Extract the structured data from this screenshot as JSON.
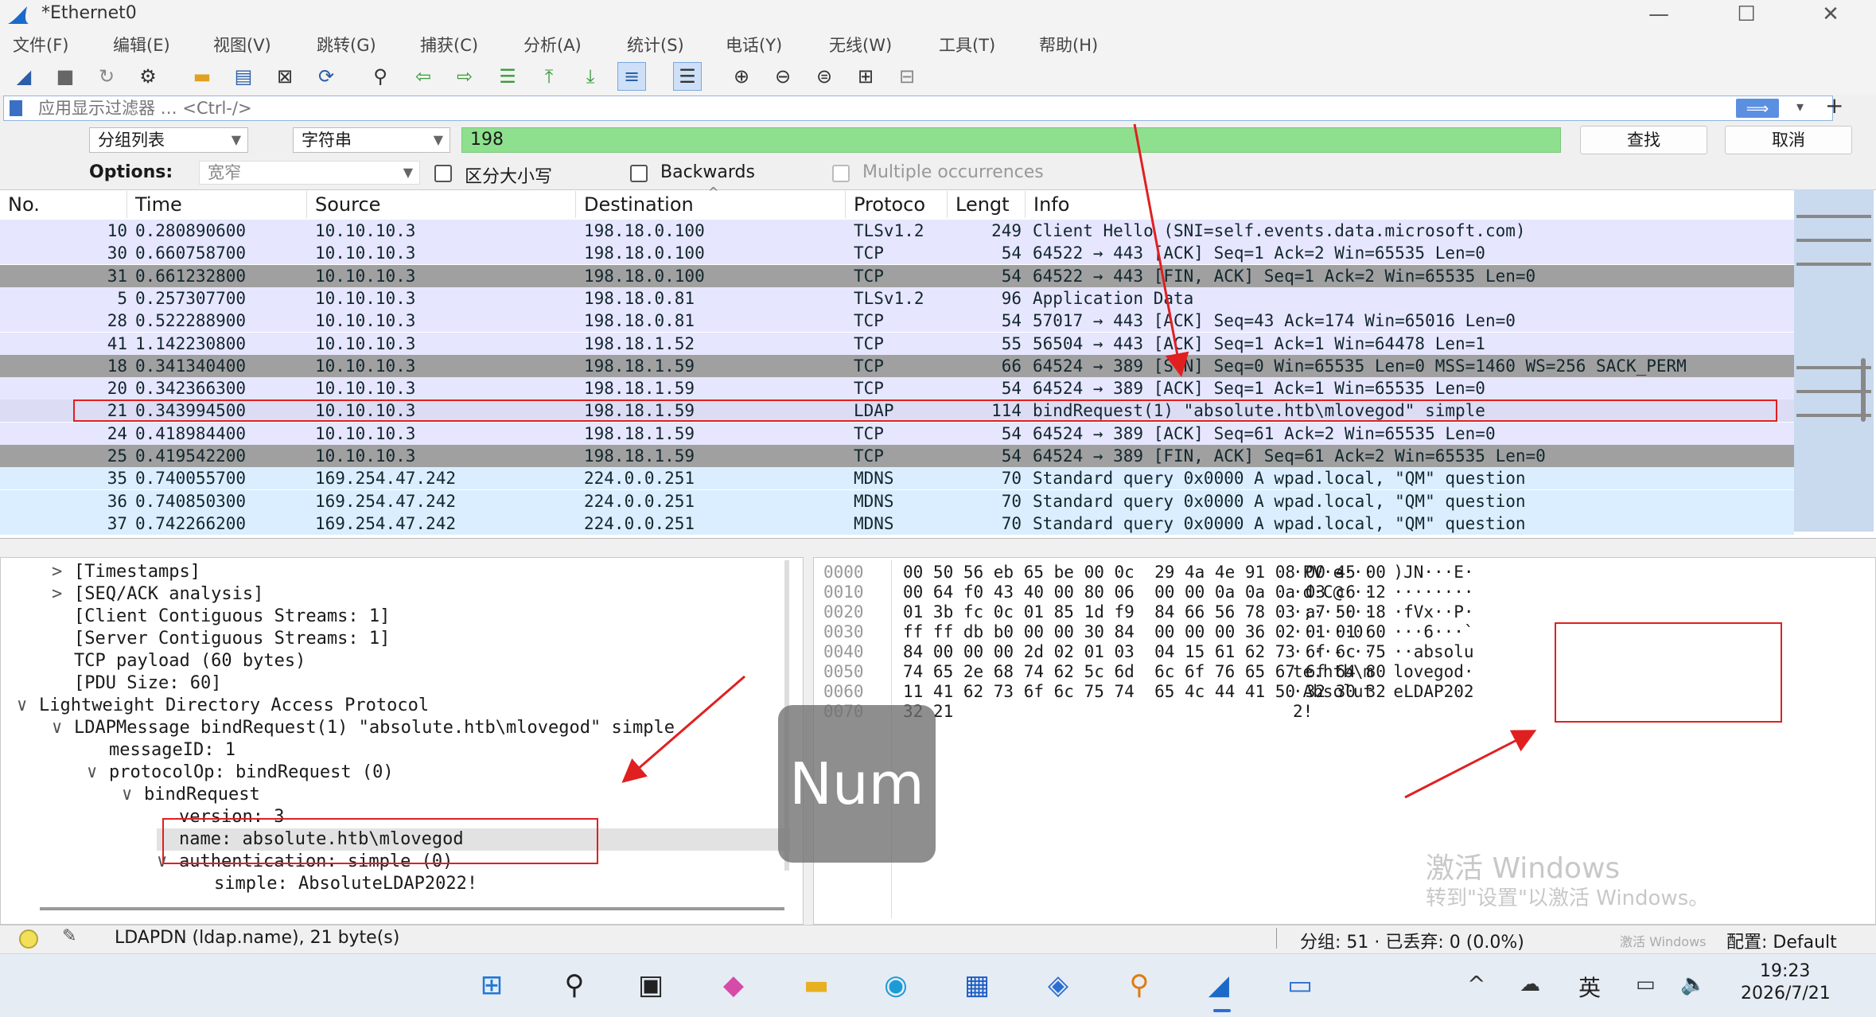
{
  "window": {
    "title": "*Ethernet0",
    "controls": [
      "—",
      "☐",
      "✕"
    ]
  },
  "menu": [
    "文件(F)",
    "编辑(E)",
    "视图(V)",
    "跳转(G)",
    "捕获(C)",
    "分析(A)",
    "统计(S)",
    "电话(Y)",
    "无线(W)",
    "工具(T)",
    "帮助(H)"
  ],
  "toolbar_icons": [
    "shark-fin-icon",
    "stop-icon",
    "restart-icon",
    "options-icon",
    "open-icon",
    "save-icon",
    "close-file-icon",
    "reload-icon",
    "find-icon",
    "back-icon",
    "forward-icon",
    "goto-icon",
    "first-icon",
    "last-icon",
    "autoscroll-icon",
    "colorize-icon",
    "zoom-in-icon",
    "zoom-out-icon",
    "zoom-reset-icon",
    "resize-columns-icon",
    "layout-icon"
  ],
  "filter": {
    "placeholder": "应用显示过滤器 … <Ctrl-/>",
    "add": "+"
  },
  "find": {
    "scope": "分组列表",
    "type": "字符串",
    "value": "198",
    "find_label": "查找",
    "cancel_label": "取消",
    "options_label": "Options:",
    "charset": "宽窄",
    "case": "区分大小写",
    "backwards": "Backwards",
    "multiple": "Multiple occurrences"
  },
  "packet_list": {
    "columns": [
      "No.",
      "Time",
      "Source",
      "Destination",
      "Protoco",
      "Lengt",
      "Info"
    ],
    "rows": [
      {
        "no": "10",
        "time": "0.280890600",
        "src": "10.10.10.3",
        "dst": "198.18.0.100",
        "proto": "TLSv1.2",
        "len": "249",
        "info": "Client Hello (SNI=self.events.data.microsoft.com)",
        "bg": "#e7e6ff",
        "fg": "#12272e"
      },
      {
        "no": "30",
        "time": "0.660758700",
        "src": "10.10.10.3",
        "dst": "198.18.0.100",
        "proto": "TCP",
        "len": "54",
        "info": "64522 → 443 [ACK] Seq=1 Ack=2 Win=65535 Len=0",
        "bg": "#e7e6ff",
        "fg": "#12272e"
      },
      {
        "no": "31",
        "time": "0.661232800",
        "src": "10.10.10.3",
        "dst": "198.18.0.100",
        "proto": "TCP",
        "len": "54",
        "info": "64522 → 443 [FIN, ACK] Seq=1 Ack=2 Win=65535 Len=0",
        "bg": "#a0a0a0",
        "fg": "#12272e"
      },
      {
        "no": "5",
        "time": "0.257307700",
        "src": "10.10.10.3",
        "dst": "198.18.0.81",
        "proto": "TLSv1.2",
        "len": "96",
        "info": "Application Data",
        "bg": "#e7e6ff",
        "fg": "#12272e"
      },
      {
        "no": "28",
        "time": "0.522288900",
        "src": "10.10.10.3",
        "dst": "198.18.0.81",
        "proto": "TCP",
        "len": "54",
        "info": "57017 → 443 [ACK] Seq=43 Ack=174 Win=65016 Len=0",
        "bg": "#e7e6ff",
        "fg": "#12272e"
      },
      {
        "no": "41",
        "time": "1.142230800",
        "src": "10.10.10.3",
        "dst": "198.18.1.52",
        "proto": "TCP",
        "len": "55",
        "info": "56504 → 443 [ACK] Seq=1 Ack=1 Win=64478 Len=1",
        "bg": "#e7e6ff",
        "fg": "#12272e"
      },
      {
        "no": "18",
        "time": "0.341340400",
        "src": "10.10.10.3",
        "dst": "198.18.1.59",
        "proto": "TCP",
        "len": "66",
        "info": "64524 → 389 [SYN] Seq=0 Win=65535 Len=0 MSS=1460 WS=256 SACK_PERM",
        "bg": "#a0a0a0",
        "fg": "#12272e"
      },
      {
        "no": "20",
        "time": "0.342366300",
        "src": "10.10.10.3",
        "dst": "198.18.1.59",
        "proto": "TCP",
        "len": "54",
        "info": "64524 → 389 [ACK] Seq=1 Ack=1 Win=65535 Len=0",
        "bg": "#e7e6ff",
        "fg": "#12272e"
      },
      {
        "no": "21",
        "time": "0.343994500",
        "src": "10.10.10.3",
        "dst": "198.18.1.59",
        "proto": "LDAP",
        "len": "114",
        "info": "bindRequest(1) \"absolute.htb\\mlovegod\" simple",
        "bg": "#dcdcf4",
        "fg": "#12272e"
      },
      {
        "no": "24",
        "time": "0.418984400",
        "src": "10.10.10.3",
        "dst": "198.18.1.59",
        "proto": "TCP",
        "len": "54",
        "info": "64524 → 389 [ACK] Seq=61 Ack=2 Win=65535 Len=0",
        "bg": "#e7e6ff",
        "fg": "#12272e"
      },
      {
        "no": "25",
        "time": "0.419542200",
        "src": "10.10.10.3",
        "dst": "198.18.1.59",
        "proto": "TCP",
        "len": "54",
        "info": "64524 → 389 [FIN, ACK] Seq=61 Ack=2 Win=65535 Len=0",
        "bg": "#a0a0a0",
        "fg": "#12272e"
      },
      {
        "no": "35",
        "time": "0.740055700",
        "src": "169.254.47.242",
        "dst": "224.0.0.251",
        "proto": "MDNS",
        "len": "70",
        "info": "Standard query 0x0000 A wpad.local, \"QM\" question",
        "bg": "#daeeff",
        "fg": "#12272e"
      },
      {
        "no": "36",
        "time": "0.740850300",
        "src": "169.254.47.242",
        "dst": "224.0.0.251",
        "proto": "MDNS",
        "len": "70",
        "info": "Standard query 0x0000 A wpad.local, \"QM\" question",
        "bg": "#daeeff",
        "fg": "#12272e"
      },
      {
        "no": "37",
        "time": "0.742266200",
        "src": "169.254.47.242",
        "dst": "224.0.0.251",
        "proto": "MDNS",
        "len": "70",
        "info": "Standard query 0x0000 A wpad.local, \"QM\" question",
        "bg": "#daeeff",
        "fg": "#12272e"
      }
    ]
  },
  "details": [
    {
      "indent": 1,
      "arrow": ">",
      "text": "[Timestamps]"
    },
    {
      "indent": 1,
      "arrow": ">",
      "text": "[SEQ/ACK analysis]"
    },
    {
      "indent": 1,
      "arrow": "",
      "text": "[Client Contiguous Streams: 1]"
    },
    {
      "indent": 1,
      "arrow": "",
      "text": "[Server Contiguous Streams: 1]"
    },
    {
      "indent": 1,
      "arrow": "",
      "text": "TCP payload (60 bytes)"
    },
    {
      "indent": 1,
      "arrow": "",
      "text": "[PDU Size: 60]"
    },
    {
      "indent": 0,
      "arrow": "∨",
      "text": "Lightweight Directory Access Protocol"
    },
    {
      "indent": 1,
      "arrow": "∨",
      "text": "LDAPMessage bindRequest(1) \"absolute.htb\\mlovegod\" simple"
    },
    {
      "indent": 2,
      "arrow": "",
      "text": "messageID: 1"
    },
    {
      "indent": 2,
      "arrow": "∨",
      "text": "protocolOp: bindRequest (0)"
    },
    {
      "indent": 3,
      "arrow": "∨",
      "text": "bindRequest"
    },
    {
      "indent": 4,
      "arrow": "",
      "text": "version: 3"
    },
    {
      "indent": 4,
      "arrow": "",
      "text": "name: absolute.htb\\mlovegod"
    },
    {
      "indent": 4,
      "arrow": "∨",
      "text": "authentication: simple (0)"
    },
    {
      "indent": 5,
      "arrow": "",
      "text": "simple: AbsoluteLDAP2022!"
    }
  ],
  "bytes": [
    {
      "off": "0000",
      "hex": "00 50 56 eb 65 be 00 0c  29 4a 4e 91 08 00 45 00",
      "ascii": "·PV·e···  )JN···E·"
    },
    {
      "off": "0010",
      "hex": "00 64 f0 43 40 00 80 06  00 00 0a 0a 0a 03 c6 12",
      "ascii": "·d·C@···  ········"
    },
    {
      "off": "0020",
      "hex": "01 3b fc 0c 01 85 1d f9  84 66 56 78 03 a7 50 18",
      "ascii": "·;······  ·fVx··P·"
    },
    {
      "off": "0030",
      "hex": "ff ff db b0 00 00 30 84  00 00 00 36 02 01 01 60",
      "ascii": "······0·  ···6···`"
    },
    {
      "off": "0040",
      "hex": "84 00 00 00 2d 02 01 03  04 15 61 62 73 6f 6c 75",
      "ascii": "····-···  ··absolu"
    },
    {
      "off": "0050",
      "hex": "74 65 2e 68 74 62 5c 6d  6c 6f 76 65 67 6f 64 80",
      "ascii": "te.htb\\m  lovegod·"
    },
    {
      "off": "0060",
      "hex": "11 41 62 73 6f 6c 75 74  65 4c 44 41 50 32 30 32",
      "ascii": "·Absolut  eLDAP202"
    },
    {
      "off": "0070",
      "hex": "32 21",
      "ascii": "2!"
    }
  ],
  "status": {
    "field": "LDAPDN (ldap.name), 21 byte(s)",
    "counts": "分组: 51 · 已丢弃: 0 (0.0%)",
    "profile": "配置: Default",
    "mini_watermark": "激活 Windows"
  },
  "overlay": {
    "num": "Num"
  },
  "watermark": {
    "line1": "激活 Windows",
    "line2": "转到\"设置\"以激活 Windows。"
  },
  "taskbar": {
    "icons": [
      "windows-start-icon",
      "search-icon",
      "task-view-icon",
      "m365-icon",
      "file-explorer-icon",
      "edge-icon",
      "store-icon",
      "python-icon",
      "magnifier-app-icon",
      "wireshark-icon",
      "monitor-icon"
    ],
    "tray_chevron": "^",
    "ime": "英",
    "time": "19:23",
    "date": "2026/7/21"
  },
  "colors": {
    "find_green": "#8ee08e",
    "selected_row": "#dcdcf4",
    "annotation_red": "#e02020"
  }
}
